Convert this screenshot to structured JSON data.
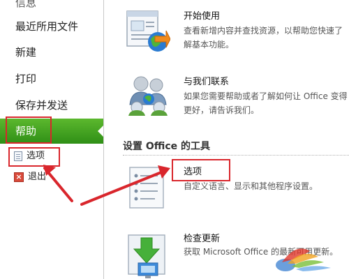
{
  "sidebar": {
    "cut_top_label": "信息",
    "items": [
      {
        "label": "最近所用文件"
      },
      {
        "label": "新建"
      },
      {
        "label": "打印"
      },
      {
        "label": "保存并发送"
      },
      {
        "label": "帮助"
      }
    ],
    "sub_items": [
      {
        "label": "选项"
      },
      {
        "label": "退出"
      }
    ]
  },
  "support": {
    "getting_started": {
      "title": "开始使用",
      "desc": "查看新增内容并查找资源，以帮助您快速了解基本功能。"
    },
    "contact": {
      "title": "与我们联系",
      "desc": "如果您需要帮助或者了解如何让 Office 变得更好，请告诉我们。"
    }
  },
  "tools": {
    "section_title": "设置 Office 的工具",
    "options": {
      "title": "选项",
      "desc": "自定义语言、显示和其他程序设置。"
    },
    "updates": {
      "title": "检查更新",
      "desc": "获取 Microsoft Office 的最新可用更新。"
    }
  },
  "colors": {
    "help_green": "#3fa31f",
    "annotation_red": "#d9262c"
  }
}
